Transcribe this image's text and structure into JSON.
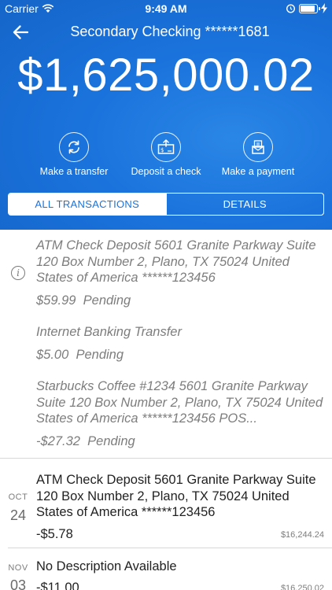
{
  "status": {
    "carrier": "Carrier",
    "time": "9:49 AM",
    "battery_level": 0.9,
    "icons": [
      "wifi-icon",
      "alarm-icon",
      "battery-icon",
      "charging-icon"
    ]
  },
  "nav": {
    "back_icon": "back-arrow-icon",
    "title": "Secondary Checking ******1681"
  },
  "balance": "$1,625,000.02",
  "actions": [
    {
      "label": "Make a transfer",
      "icon": "transfer-icon"
    },
    {
      "label": "Deposit a check",
      "icon": "deposit-check-icon"
    },
    {
      "label": "Make a payment",
      "icon": "payment-icon"
    }
  ],
  "tabs": [
    {
      "label": "ALL TRANSACTIONS",
      "active": true
    },
    {
      "label": "DETAILS",
      "active": false
    }
  ],
  "pending": {
    "icon": "info-icon",
    "items": [
      {
        "description": "ATM Check Deposit 5601 Granite Parkway Suite 120 Box Number 2, Plano, TX 75024 United States of America ******123456",
        "amount": "$59.99",
        "status": "Pending"
      },
      {
        "description": "Internet Banking Transfer",
        "amount": "$5.00",
        "status": "Pending"
      },
      {
        "description": "Starbucks Coffee #1234 5601 Granite Parkway Suite 120 Box Number 2, Plano, TX 75024 United States of America ******123456 POS...",
        "amount": "-$27.32",
        "status": "Pending"
      }
    ]
  },
  "posted": [
    {
      "month": "OCT",
      "day": "24",
      "description": "ATM Check Deposit 5601 Granite Parkway Suite 120 Box Number 2, Plano, TX 75024 United States of America ******123456",
      "amount": "-$5.78",
      "running_balance": "$16,244.24"
    },
    {
      "month": "NOV",
      "day": "03",
      "description": "No Description Available",
      "amount": "-$11.00",
      "running_balance": "$16,250.02"
    }
  ],
  "colors": {
    "header_blue": "#1a73dc",
    "pending_text": "#7d7d7d",
    "divider": "#d8d8d8"
  }
}
